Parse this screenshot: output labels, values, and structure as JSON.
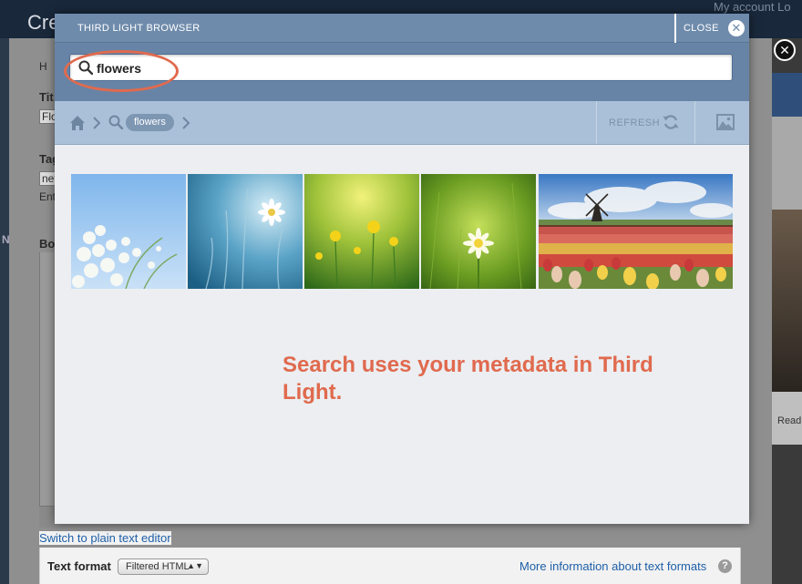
{
  "background": {
    "page_title_fragment": "Cre",
    "account_links": "My account   Lo",
    "fragments": {
      "breadcrumb": "H",
      "title_label": "Tit",
      "title_value": "Flo",
      "tags_label": "Tag",
      "tags_value": "net",
      "tags_help": "Ent",
      "body_label": "Bo",
      "side_letter": "N"
    },
    "switch_link": "Switch to plain text editor",
    "text_format_label": "Text format",
    "text_format_value": "Filtered HTML",
    "format_info_link": "More information about text formats",
    "right_read": "Read"
  },
  "modal": {
    "title": "THIRD LIGHT BROWSER",
    "close_label": "CLOSE",
    "search": {
      "value": "flowers"
    },
    "toolbar": {
      "breadcrumb_term": "flowers",
      "refresh_label": "REFRESH"
    },
    "thumbnails": [
      {
        "name": "white-blossoms-blue-sky"
      },
      {
        "name": "daisy-teal-grass"
      },
      {
        "name": "yellow-buttercups"
      },
      {
        "name": "dandelion-green-field"
      },
      {
        "name": "windmill-tulip-field"
      }
    ],
    "annotation": "Search uses your metadata in Third Light."
  },
  "colors": {
    "accent_annotation": "#e06a4e",
    "header_blue": "#6f8bab",
    "toolbar_blue": "#a9c0d8"
  }
}
